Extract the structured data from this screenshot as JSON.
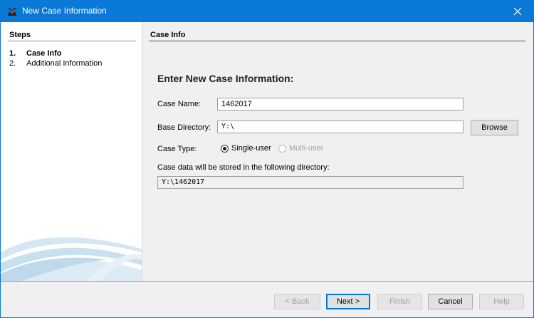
{
  "window": {
    "title": "New Case Information"
  },
  "steps": {
    "header": "Steps",
    "items": [
      {
        "num": "1.",
        "label": "Case Info"
      },
      {
        "num": "2.",
        "label": "Additional Information"
      }
    ]
  },
  "content": {
    "header": "Case Info",
    "heading": "Enter New Case Information:",
    "case_name": {
      "label": "Case Name:",
      "value": "1462017"
    },
    "base_directory": {
      "label": "Base Directory:",
      "value": "Y:\\",
      "browse_label": "Browse"
    },
    "case_type": {
      "label": "Case Type:",
      "options": [
        "Single-user",
        "Multi-user"
      ],
      "selected": "Single-user"
    },
    "storage": {
      "label": "Case data will be stored in the following directory:",
      "value": "Y:\\1462017"
    }
  },
  "buttons": {
    "back": "< Back",
    "next": "Next >",
    "finish": "Finish",
    "cancel": "Cancel",
    "help": "Help"
  },
  "colors": {
    "titlebar": "#0a78d7",
    "swoosh": "#c9e0ef"
  }
}
